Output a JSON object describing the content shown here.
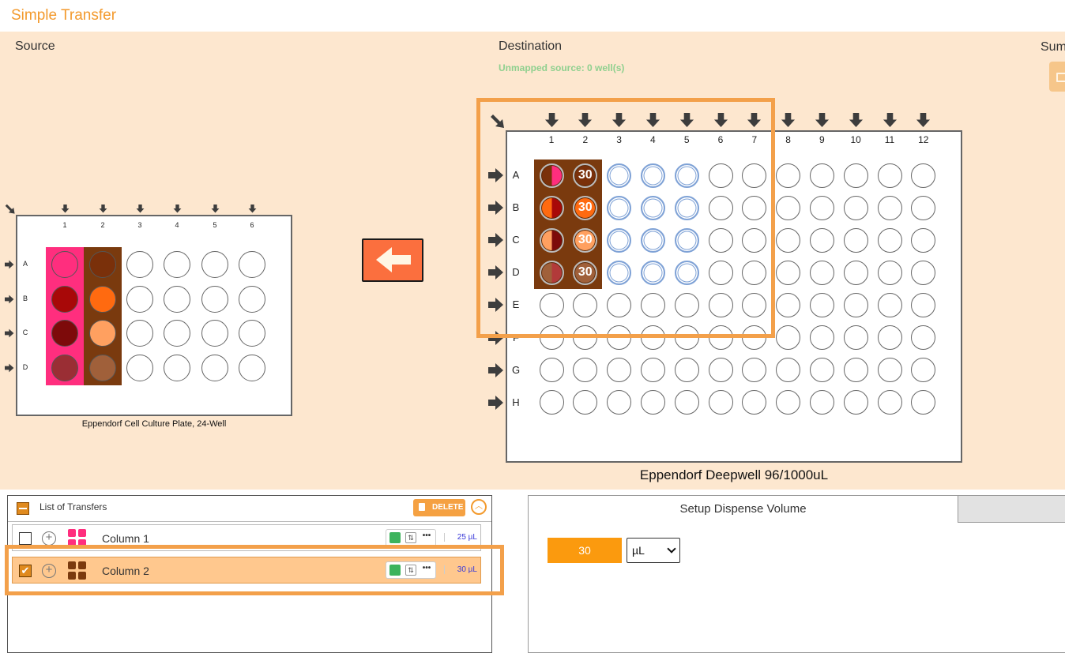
{
  "app": {
    "title": "Simple Transfer"
  },
  "source": {
    "section_label": "Source",
    "plate_name": "Eppendorf Cell Culture Plate, 24-Well",
    "columns": [
      "1",
      "2",
      "3",
      "4",
      "5",
      "6"
    ],
    "rows": [
      "A",
      "B",
      "C",
      "D"
    ],
    "well_colors": {
      "1": [
        "#ff2e7e",
        "#a80808",
        "#7d0a0a",
        "#9a2e34"
      ],
      "2": [
        "#7a300a",
        "#ff6a10",
        "#ffa060",
        "#a0603a"
      ]
    },
    "column_bg": {
      "1": "#ff2e7e",
      "2": "#7a3a0e"
    }
  },
  "destination": {
    "section_label": "Destination",
    "unmapped_text": "Unmapped source: 0 well(s)",
    "plate_name": "Eppendorf Deepwell 96/1000uL",
    "columns": [
      "1",
      "2",
      "3",
      "4",
      "5",
      "6",
      "7",
      "8",
      "9",
      "10",
      "11",
      "12"
    ],
    "rows": [
      "A",
      "B",
      "C",
      "D",
      "E",
      "F",
      "G",
      "H"
    ],
    "column1_halves": [
      [
        "#7a300a",
        "#ff2e7e"
      ],
      [
        "#ff6a10",
        "#a80808"
      ],
      [
        "#ffa060",
        "#7d0a0a"
      ],
      [
        "#a0603a",
        "#b23a3a"
      ]
    ],
    "column2_fill": [
      "#7a300a",
      "#ff6a10",
      "#ffa060",
      "#a0603a"
    ],
    "column2_labels": [
      "30",
      "30",
      "30",
      "30"
    ],
    "mapped_columns": [
      "3",
      "4",
      "5"
    ]
  },
  "summary_label": "Sum",
  "transfers": {
    "title": "List of Transfers",
    "delete_label": "DELETE",
    "items": [
      {
        "label": "Column 1",
        "volume": "25 µL",
        "checked": false,
        "swatch": "#ff2e7e"
      },
      {
        "label": "Column 2",
        "volume": "30 µL",
        "checked": true,
        "swatch": "#7a3a0e"
      }
    ]
  },
  "dispense": {
    "tab_label": "Setup Dispense Volume",
    "volume_value": "30",
    "unit": "µL"
  },
  "colors": {
    "accent": "#f39a2d",
    "panel_bg": "#fde7cf",
    "highlight": "#f3a04a"
  }
}
